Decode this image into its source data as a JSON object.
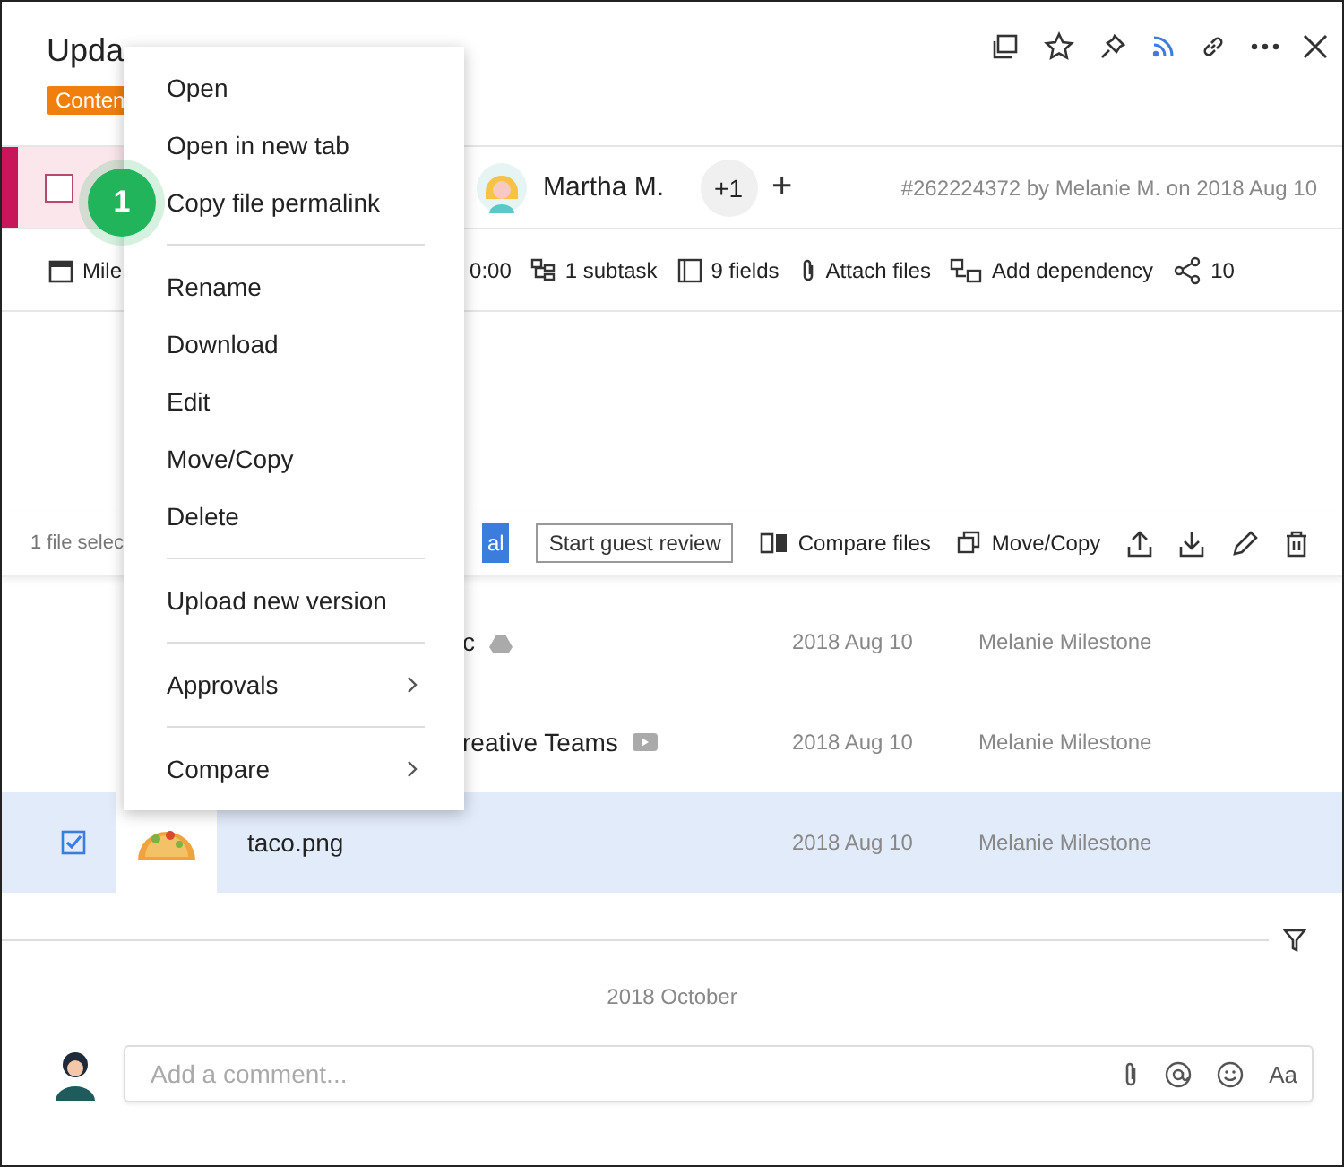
{
  "window": {
    "title": "Upda",
    "tag": "Conten"
  },
  "task_row": {
    "checked": false,
    "assignee": "Martha M.",
    "more_assignees": "+1",
    "add": "+",
    "meta": "#262224372 by Melanie M. on 2018 Aug 10"
  },
  "task_toolbar": [
    {
      "kind": "calendar",
      "label": "Mile"
    },
    {
      "kind": "time",
      "label": "0:00"
    },
    {
      "kind": "subtask",
      "label": "1 subtask"
    },
    {
      "kind": "fields",
      "label": "9 fields"
    },
    {
      "kind": "attach",
      "label": "Attach files"
    },
    {
      "kind": "dependency",
      "label": "Add dependency"
    },
    {
      "kind": "share",
      "label": "10"
    }
  ],
  "files_toolbar": {
    "selection": "1 file selec",
    "primary": "al",
    "guest_review": "Start guest review",
    "actions": [
      {
        "kind": "compare",
        "label": "Compare files"
      },
      {
        "kind": "move",
        "label": "Move/Copy"
      }
    ]
  },
  "files": [
    {
      "name": "c",
      "kind": "drive",
      "date": "2018 Aug 10",
      "owner": "Melanie Milestone",
      "selected": false,
      "checked": false
    },
    {
      "name": "reative Teams",
      "kind": "video",
      "date": "2018 Aug 10",
      "owner": "Melanie Milestone",
      "selected": false,
      "checked": false
    },
    {
      "name": "taco.png",
      "kind": "image",
      "date": "2018 Aug 10",
      "owner": "Melanie Milestone",
      "selected": true,
      "checked": true
    }
  ],
  "comments": {
    "date": "2018 October",
    "placeholder": "Add a comment...",
    "format": "Aa"
  },
  "context_menu": {
    "step": "1",
    "groups": [
      [
        {
          "label": "Open",
          "submenu": false
        },
        {
          "label": "Open in new tab",
          "submenu": false
        },
        {
          "label": "Copy file permalink",
          "submenu": false
        }
      ],
      [
        {
          "label": "Rename",
          "submenu": false
        },
        {
          "label": "Download",
          "submenu": false
        },
        {
          "label": "Edit",
          "submenu": false
        },
        {
          "label": "Move/Copy",
          "submenu": false
        },
        {
          "label": "Delete",
          "submenu": false
        }
      ],
      [
        {
          "label": "Upload new version",
          "submenu": false
        }
      ],
      [
        {
          "label": "Approvals",
          "submenu": true
        }
      ],
      [
        {
          "label": "Compare",
          "submenu": true
        }
      ]
    ]
  }
}
